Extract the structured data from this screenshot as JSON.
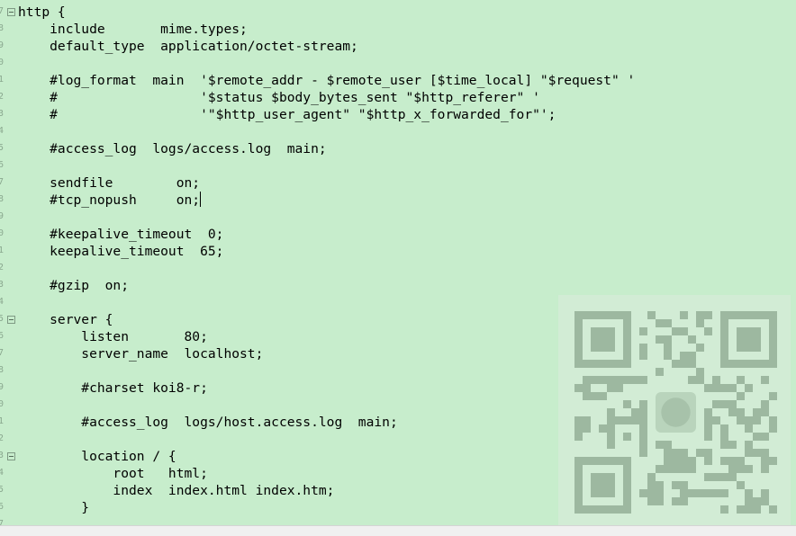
{
  "editor": {
    "language": "nginx",
    "background": "#c7edcc",
    "caret_line": 12,
    "lines": [
      "http {",
      "    include       mime.types;",
      "    default_type  application/octet-stream;",
      "",
      "    #log_format  main  '$remote_addr - $remote_user [$time_local] \"$request\" '",
      "    #                  '$status $body_bytes_sent \"$http_referer\" '",
      "    #                  '\"$http_user_agent\" \"$http_x_forwarded_for\"';",
      "",
      "    #access_log  logs/access.log  main;",
      "",
      "    sendfile        on;",
      "    #tcp_nopush     on;",
      "",
      "    #keepalive_timeout  0;",
      "    keepalive_timeout  65;",
      "",
      "    #gzip  on;",
      "",
      "    server {",
      "        listen       80;",
      "        server_name  localhost;",
      "",
      "        #charset koi8-r;",
      "",
      "        #access_log  logs/host.access.log  main;",
      "",
      "        location / {",
      "            root   html;",
      "            index  index.html index.htm;",
      "        }"
    ],
    "gutter_digits": [
      "7",
      "8",
      "9",
      "0",
      "1",
      "2",
      "3",
      "4",
      "5",
      "6",
      "7",
      "8",
      "9",
      "0",
      "1",
      "2",
      "3",
      "4",
      "5",
      "6",
      "7",
      "8",
      "9",
      "0",
      "1",
      "2",
      "3",
      "4",
      "5",
      "6",
      "7"
    ],
    "fold_lines": [
      1,
      19,
      27
    ]
  },
  "overlay": {
    "icon": "qr-code-watermark-icon",
    "color": "#9db8a0"
  }
}
